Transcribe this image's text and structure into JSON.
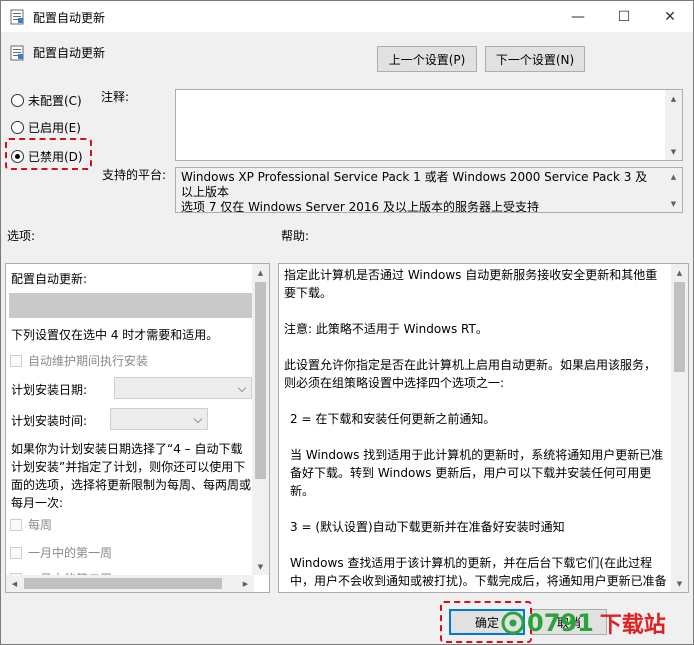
{
  "window": {
    "title": "配置自动更新",
    "controls": {
      "minimize": "—",
      "maximize": "☐",
      "close": "✕"
    }
  },
  "header": {
    "policy_name": "配置自动更新",
    "prev_button": "上一个设置(P)",
    "next_button": "下一个设置(N)"
  },
  "state": {
    "options": [
      {
        "label": "未配置(C)",
        "selected": false
      },
      {
        "label": "已启用(E)",
        "selected": false
      },
      {
        "label": "已禁用(D)",
        "selected": true
      }
    ]
  },
  "comment": {
    "label": "注释:",
    "value": ""
  },
  "platform": {
    "label": "支持的平台:",
    "text": "Windows XP Professional Service Pack 1 或者 Windows 2000 Service Pack 3 及以上版本",
    "text_cut": "选项 7 仅在 Windows Server 2016 及以上版本的服务器上受支持"
  },
  "options_section": {
    "label": "选项:",
    "title": "配置自动更新:",
    "applies_note": "下列设置仅在选中 4 时才需要和适用。",
    "maintenance_checkbox": "自动维护期间执行安装",
    "schedule_day_label": "计划安装日期:",
    "schedule_time_label": "计划安装时间:",
    "schedule_note": "如果你为计划安装日期选择了“4 – 自动下载计划安装”并指定了计划，则你还可以使用下面的选项，选择将更新限制为每周、每两周或每月一次:",
    "weekly_checkbox": "每周",
    "first_week_checkbox": "一月中的第一周",
    "second_week_checkbox": "一月中的第二周"
  },
  "help_section": {
    "label": "帮助:",
    "paragraphs": [
      "指定此计算机是否通过 Windows 自动更新服务接收安全更新和其他重要下载。",
      "注意: 此策略不适用于 Windows RT。",
      "此设置允许你指定是否在此计算机上启用自动更新。如果启用该服务，则必须在组策略设置中选择四个选项之一:",
      "2 = 在下载和安装任何更新之前通知。",
      "当 Windows 找到适用于此计算机的更新时，系统将通知用户更新已准备好下载。转到 Windows 更新后，用户可以下载并安装任何可用更新。",
      "3 = (默认设置)自动下载更新并在准备好安装时通知",
      "Windows 查找适用于该计算机的更新，并在后台下载它们(在此过程中，用户不会收到通知或被打扰)。下载完成后，将通知用户更新已准备好进行安装。在转到 Windows 更新后，用户可以安装它们。"
    ]
  },
  "footer": {
    "ok_button": "确定",
    "cancel_button": "取消"
  },
  "watermark": {
    "logo_text": "0791",
    "site_text": "下载站"
  },
  "colors": {
    "highlight": "#d0121b",
    "watermark_green": "#2aa43a",
    "watermark_red": "#e02020",
    "ok_border": "#0078d7"
  }
}
